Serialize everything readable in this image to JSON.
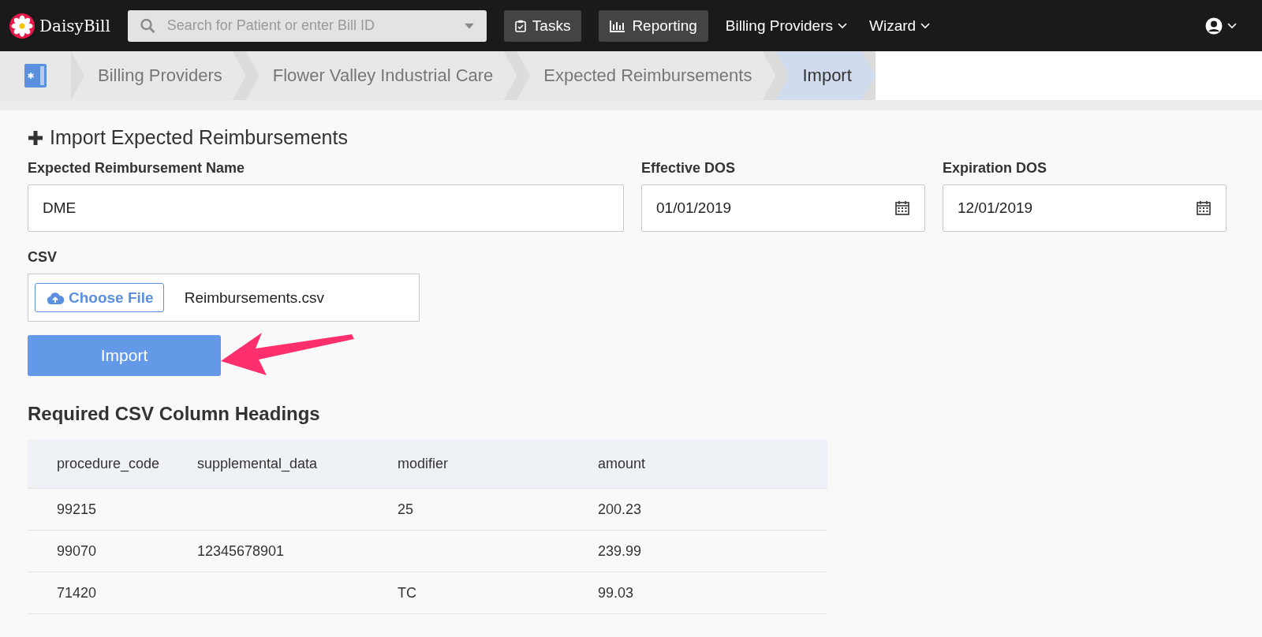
{
  "brand": {
    "name": "DaisyBill"
  },
  "search": {
    "placeholder": "Search for Patient or enter Bill ID"
  },
  "nav": [
    {
      "label": "Tasks",
      "kind": "button"
    },
    {
      "label": "Reporting",
      "kind": "button"
    },
    {
      "label": "Billing Providers",
      "kind": "menu"
    },
    {
      "label": "Wizard",
      "kind": "menu"
    }
  ],
  "breadcrumbs": [
    {
      "label": "Billing Providers",
      "selected": false
    },
    {
      "label": "Flower Valley Industrial Care",
      "selected": false
    },
    {
      "label": "Expected Reimbursements",
      "selected": false
    },
    {
      "label": "Import",
      "selected": true
    }
  ],
  "form": {
    "title": "Import Expected Reimbursements",
    "fields": [
      {
        "label": "Expected Reimbursement Name",
        "value": "DME",
        "kind": "text"
      },
      {
        "label": "Effective DOS",
        "value": "01/01/2019",
        "kind": "date"
      },
      {
        "label": "Expiration DOS",
        "value": "12/01/2019",
        "kind": "date"
      }
    ],
    "csv": {
      "label": "CSV",
      "button": "Choose File",
      "file": "Reimbursements.csv"
    },
    "submit": "Import"
  },
  "table": {
    "title": "Required CSV Column Headings",
    "columns": [
      "procedure_code",
      "supplemental_data",
      "modifier",
      "amount"
    ],
    "rows": [
      [
        "99215",
        "",
        "25",
        "200.23"
      ],
      [
        "99070",
        "12345678901",
        "",
        "239.99"
      ],
      [
        "71420",
        "",
        "TC",
        "99.03"
      ]
    ]
  }
}
